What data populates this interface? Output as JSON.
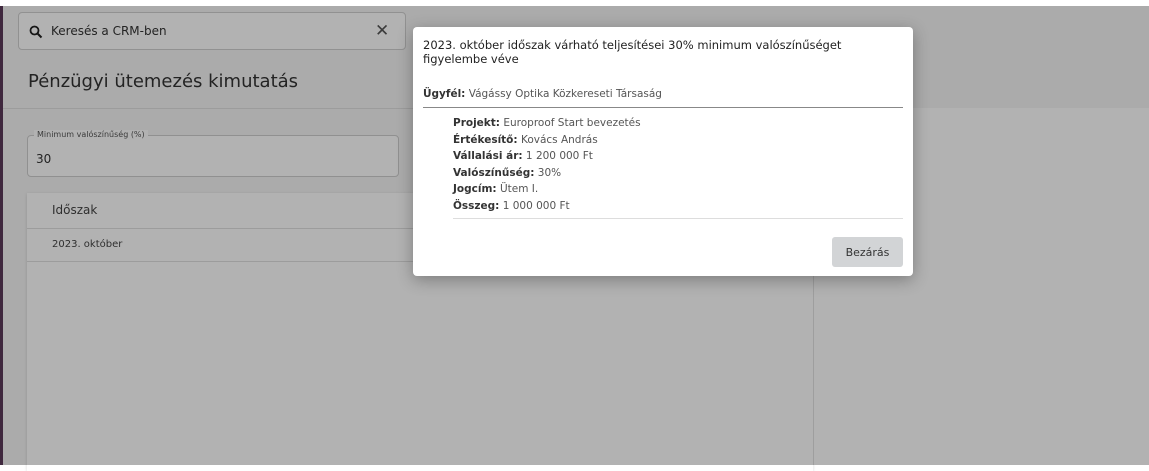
{
  "search": {
    "placeholder": "Keresés a CRM-ben"
  },
  "page": {
    "title": "Pénzügyi ütemezés kimutatás"
  },
  "filter": {
    "label": "Minimum valószínűség (%)",
    "value": "30"
  },
  "table": {
    "column_header": "Időszak",
    "rows": [
      "2023. október"
    ]
  },
  "dialog": {
    "title": "2023. október időszak várható teljesítései 30% minimum valószínűséget figyelembe véve",
    "client_label": "Ügyfél:",
    "client_value": "Vágássy Optika Közkereseti Társaság",
    "details": [
      {
        "label": "Projekt:",
        "value": "Europroof Start bevezetés"
      },
      {
        "label": "Értékesítő:",
        "value": "Kovács András"
      },
      {
        "label": "Vállalási ár:",
        "value": "1 200 000 Ft"
      },
      {
        "label": "Valószínűség:",
        "value": "30%"
      },
      {
        "label": "Jogcím:",
        "value": "Ütem I."
      },
      {
        "label": "Összeg:",
        "value": "1 000 000 Ft"
      }
    ],
    "close_label": "Bezárás"
  }
}
